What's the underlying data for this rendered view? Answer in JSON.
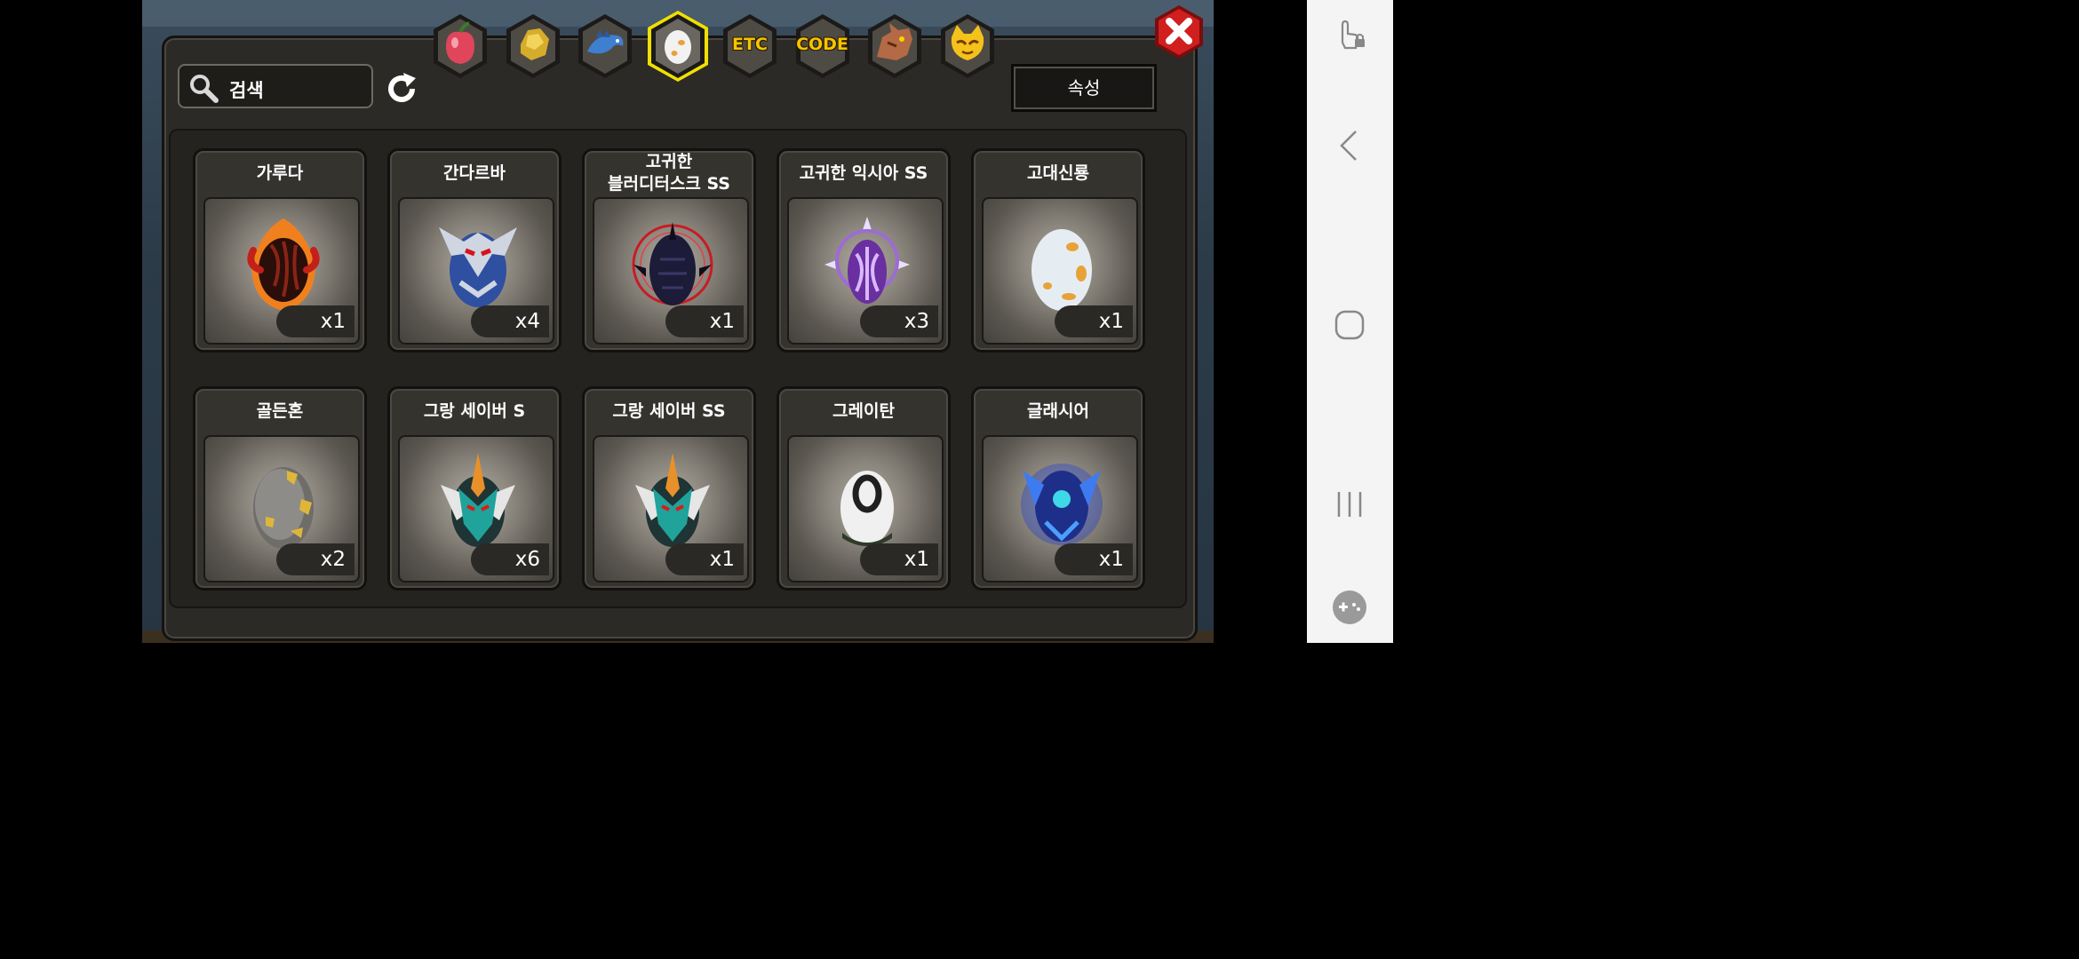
{
  "search": {
    "label": "검색",
    "icon": "search-icon"
  },
  "refresh": {
    "icon": "refresh-icon"
  },
  "attribute_button": {
    "label": "속성"
  },
  "close": {
    "icon": "close-icon"
  },
  "tabs": [
    {
      "icon": "fruit-icon",
      "label": ""
    },
    {
      "icon": "ore-icon",
      "label": ""
    },
    {
      "icon": "dragon-fish-icon",
      "label": ""
    },
    {
      "icon": "egg-icon",
      "label": "",
      "selected": true
    },
    {
      "icon": "etc-icon",
      "label": "ETC"
    },
    {
      "icon": "code-icon",
      "label": "CODE"
    },
    {
      "icon": "dragon-head-icon",
      "label": ""
    },
    {
      "icon": "cat-mask-icon",
      "label": ""
    }
  ],
  "items": [
    {
      "name": "가루다",
      "qty": "x1",
      "icon": "fire-egg-icon"
    },
    {
      "name": "간다르바",
      "qty": "x4",
      "icon": "blue-armor-egg-icon"
    },
    {
      "name": "고귀한\n블러디터스크 SS",
      "qty": "x1",
      "icon": "dark-spike-egg-icon"
    },
    {
      "name": "고귀한 익시아 SS",
      "qty": "x3",
      "icon": "purple-egg-icon"
    },
    {
      "name": "고대신룡",
      "qty": "x1",
      "icon": "spotted-egg-icon"
    },
    {
      "name": "골든혼",
      "qty": "x2",
      "icon": "gold-spot-egg-icon"
    },
    {
      "name": "그랑 세이버 S",
      "qty": "x6",
      "icon": "green-armor-egg-icon"
    },
    {
      "name": "그랑 세이버 SS",
      "qty": "x1",
      "icon": "green-armor-egg-icon"
    },
    {
      "name": "그레이탄",
      "qty": "x1",
      "icon": "zero-egg-icon"
    },
    {
      "name": "글래시어",
      "qty": "x1",
      "icon": "blue-crystal-egg-icon"
    }
  ],
  "colors": {
    "tab_text": "#f5c400",
    "selected_tab_border": "#f0e000",
    "close_red": "#d11f1f"
  },
  "nav": {
    "icons": [
      "touch-lock-icon",
      "back-icon",
      "home-icon",
      "recents-icon",
      "gamepad-icon"
    ]
  }
}
